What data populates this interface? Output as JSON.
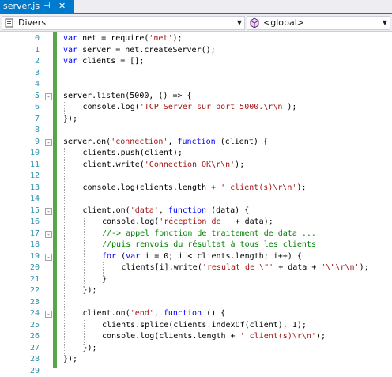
{
  "tab": {
    "filename": "server.js",
    "pin_glyph": "⊣",
    "close_glyph": "✕"
  },
  "nav": {
    "scope_label": "Divers",
    "member_label": "<global>",
    "dropdown_glyph": "▼"
  },
  "icons": {
    "scope": "file-project-icon",
    "member": "cube-icon"
  },
  "colors": {
    "accent": "#007acc",
    "keyword": "#0000ff",
    "string": "#a31515",
    "comment": "#008000",
    "line_number": "#2b91af",
    "change_bar": "#57a64a"
  },
  "editor": {
    "lines": [
      {
        "n": "0",
        "fold": "",
        "indent": 0,
        "tokens": [
          {
            "t": "var",
            "c": "kw"
          },
          {
            "t": " net = require("
          },
          {
            "t": "'net'",
            "c": "str"
          },
          {
            "t": ");"
          }
        ]
      },
      {
        "n": "1",
        "fold": "",
        "indent": 0,
        "tokens": [
          {
            "t": "var",
            "c": "kw"
          },
          {
            "t": " server = net.createServer();"
          }
        ]
      },
      {
        "n": "2",
        "fold": "",
        "indent": 0,
        "tokens": [
          {
            "t": "var",
            "c": "kw"
          },
          {
            "t": " clients = [];"
          }
        ]
      },
      {
        "n": "3",
        "fold": "",
        "indent": 0,
        "tokens": []
      },
      {
        "n": "4",
        "fold": "",
        "indent": 0,
        "tokens": []
      },
      {
        "n": "5",
        "fold": "-",
        "indent": 0,
        "tokens": [
          {
            "t": "server.listen(5000, () => {"
          }
        ]
      },
      {
        "n": "6",
        "fold": "",
        "indent": 1,
        "tokens": [
          {
            "t": "console.log("
          },
          {
            "t": "'TCP Server sur port 5000.\\r\\n'",
            "c": "str"
          },
          {
            "t": ");"
          }
        ]
      },
      {
        "n": "7",
        "fold": "",
        "indent": 0,
        "tokens": [
          {
            "t": "});"
          }
        ]
      },
      {
        "n": "8",
        "fold": "",
        "indent": 0,
        "tokens": []
      },
      {
        "n": "9",
        "fold": "-",
        "indent": 0,
        "tokens": [
          {
            "t": "server.on("
          },
          {
            "t": "'connection'",
            "c": "str"
          },
          {
            "t": ", "
          },
          {
            "t": "function",
            "c": "kw"
          },
          {
            "t": " (client) {"
          }
        ]
      },
      {
        "n": "10",
        "fold": "",
        "indent": 1,
        "tokens": [
          {
            "t": "clients.push(client);"
          }
        ]
      },
      {
        "n": "11",
        "fold": "",
        "indent": 1,
        "tokens": [
          {
            "t": "client.write("
          },
          {
            "t": "'Connection OK\\r\\n'",
            "c": "str"
          },
          {
            "t": ");"
          }
        ]
      },
      {
        "n": "12",
        "fold": "",
        "indent": 0,
        "tokens": []
      },
      {
        "n": "13",
        "fold": "",
        "indent": 1,
        "tokens": [
          {
            "t": "console.log(clients.length + "
          },
          {
            "t": "' client(s)\\r\\n'",
            "c": "str"
          },
          {
            "t": ");"
          }
        ]
      },
      {
        "n": "14",
        "fold": "",
        "indent": 0,
        "tokens": []
      },
      {
        "n": "15",
        "fold": "-",
        "indent": 1,
        "tokens": [
          {
            "t": "client.on("
          },
          {
            "t": "'data'",
            "c": "str"
          },
          {
            "t": ", "
          },
          {
            "t": "function",
            "c": "kw"
          },
          {
            "t": " (data) {"
          }
        ]
      },
      {
        "n": "16",
        "fold": "",
        "indent": 2,
        "tokens": [
          {
            "t": "console.log("
          },
          {
            "t": "'réception de '",
            "c": "str"
          },
          {
            "t": " + data);"
          }
        ]
      },
      {
        "n": "17",
        "fold": "-",
        "indent": 2,
        "tokens": [
          {
            "t": "//-> appel fonction de traitement de data ...",
            "c": "cm"
          }
        ]
      },
      {
        "n": "18",
        "fold": "",
        "indent": 2,
        "tokens": [
          {
            "t": "//puis renvois du résultat à tous les clients",
            "c": "cm"
          }
        ]
      },
      {
        "n": "19",
        "fold": "-",
        "indent": 2,
        "tokens": [
          {
            "t": "for",
            "c": "kw"
          },
          {
            "t": " ("
          },
          {
            "t": "var",
            "c": "kw"
          },
          {
            "t": " i = 0; i < clients.length; i++) {"
          }
        ]
      },
      {
        "n": "20",
        "fold": "",
        "indent": 3,
        "tokens": [
          {
            "t": "clients[i].write("
          },
          {
            "t": "'resulat de \\\"'",
            "c": "str"
          },
          {
            "t": " + data + "
          },
          {
            "t": "'\\\"\\r\\n'",
            "c": "str"
          },
          {
            "t": ");"
          }
        ]
      },
      {
        "n": "21",
        "fold": "",
        "indent": 2,
        "tokens": [
          {
            "t": "}"
          }
        ]
      },
      {
        "n": "22",
        "fold": "",
        "indent": 1,
        "tokens": [
          {
            "t": "});"
          }
        ]
      },
      {
        "n": "23",
        "fold": "",
        "indent": 0,
        "tokens": []
      },
      {
        "n": "24",
        "fold": "-",
        "indent": 1,
        "tokens": [
          {
            "t": "client.on("
          },
          {
            "t": "'end'",
            "c": "str"
          },
          {
            "t": ", "
          },
          {
            "t": "function",
            "c": "kw"
          },
          {
            "t": " () {"
          }
        ]
      },
      {
        "n": "25",
        "fold": "",
        "indent": 2,
        "tokens": [
          {
            "t": "clients.splice(clients.indexOf(client), 1);"
          }
        ]
      },
      {
        "n": "26",
        "fold": "",
        "indent": 2,
        "tokens": [
          {
            "t": "console.log(clients.length + "
          },
          {
            "t": "' client(s)\\r\\n'",
            "c": "str"
          },
          {
            "t": ");"
          }
        ]
      },
      {
        "n": "27",
        "fold": "",
        "indent": 1,
        "tokens": [
          {
            "t": "});"
          }
        ]
      },
      {
        "n": "28",
        "fold": "",
        "indent": 0,
        "tokens": [
          {
            "t": "});"
          }
        ]
      },
      {
        "n": "29",
        "fold": "",
        "indent": 0,
        "tokens": []
      }
    ]
  }
}
